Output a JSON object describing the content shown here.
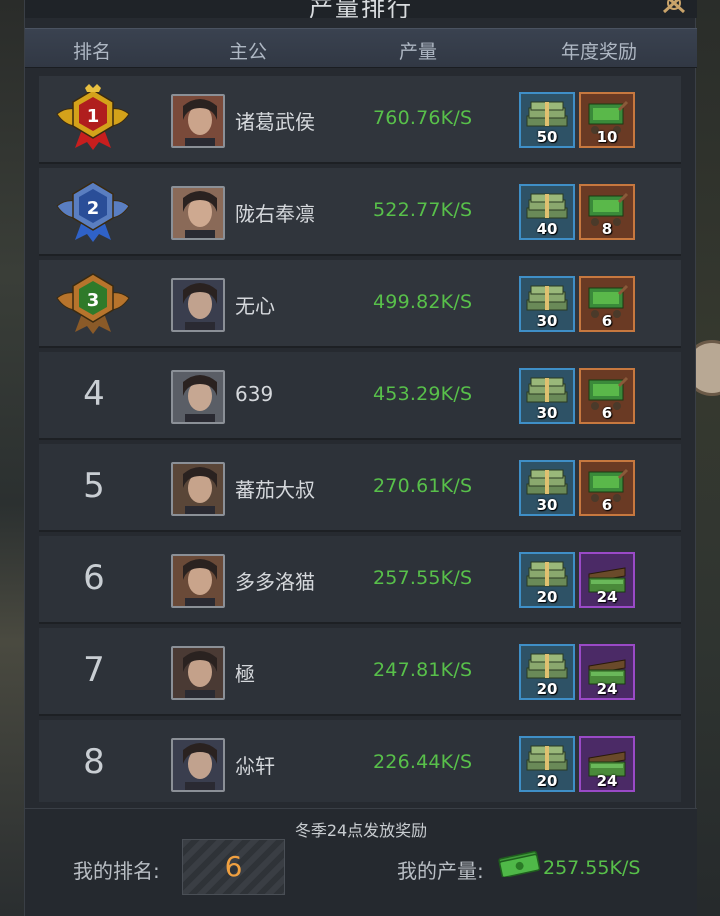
{
  "panel": {
    "title": "产量排行"
  },
  "columns": {
    "rank": "排名",
    "lord": "主公",
    "output": "产量",
    "reward": "年度奖励"
  },
  "rows": [
    {
      "rank": "1",
      "name": "诸葛武侯",
      "output": "760.76K/S",
      "reward1_qty": "50",
      "reward2_qty": "10",
      "reward2_type": "orange"
    },
    {
      "rank": "2",
      "name": "陇右奉凛",
      "output": "522.77K/S",
      "reward1_qty": "40",
      "reward2_qty": "8",
      "reward2_type": "orange"
    },
    {
      "rank": "3",
      "name": "无心",
      "output": "499.82K/S",
      "reward1_qty": "30",
      "reward2_qty": "6",
      "reward2_type": "orange"
    },
    {
      "rank": "4",
      "name": "639",
      "output": "453.29K/S",
      "reward1_qty": "30",
      "reward2_qty": "6",
      "reward2_type": "orange"
    },
    {
      "rank": "5",
      "name": "蕃茄大叔",
      "output": "270.61K/S",
      "reward1_qty": "30",
      "reward2_qty": "6",
      "reward2_type": "orange"
    },
    {
      "rank": "6",
      "name": "多多洛猫",
      "output": "257.55K/S",
      "reward1_qty": "20",
      "reward2_qty": "24",
      "reward2_type": "purple"
    },
    {
      "rank": "7",
      "name": "極",
      "output": "247.81K/S",
      "reward1_qty": "20",
      "reward2_qty": "24",
      "reward2_type": "purple"
    },
    {
      "rank": "8",
      "name": "尛轩",
      "output": "226.44K/S",
      "reward1_qty": "20",
      "reward2_qty": "24",
      "reward2_type": "purple"
    }
  ],
  "footer": {
    "note": "冬季24点发放奖励",
    "my_rank_label": "我的排名:",
    "my_rank_value": "6",
    "my_output_label": "我的产量:",
    "my_output_value": "257.55K/S"
  },
  "colors": {
    "output_green": "#58c04a",
    "rank_highlight": "#f0a040",
    "gold_medal": "#d4a21a",
    "silver_medal": "#5a7ec0",
    "bronze_medal": "#b7742c"
  }
}
